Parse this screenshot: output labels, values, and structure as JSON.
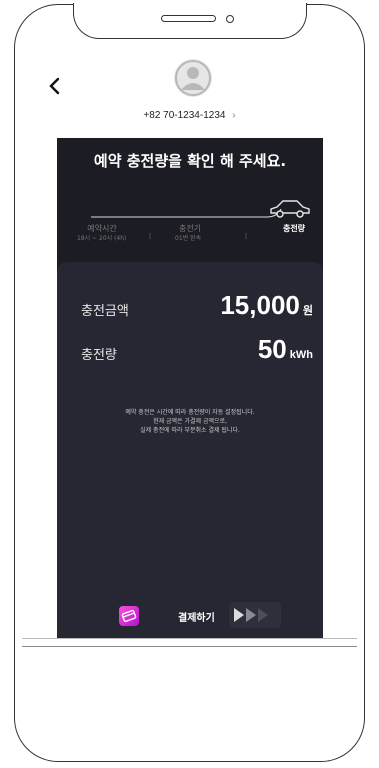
{
  "header": {
    "back_icon": "chevron-left-icon",
    "avatar_icon": "user-icon",
    "phone_number": "+82 70-1234-1234",
    "phone_chevron": "›"
  },
  "screen": {
    "title": "예약 충전량을 확인 해 주세요.",
    "steps": [
      {
        "label": "예약시간",
        "sub": "18시 ~ 20시 (4h)"
      },
      {
        "label": "충전기",
        "sub": "01번 완속"
      },
      {
        "label": "충전량",
        "sub": ""
      }
    ],
    "active_step": 2,
    "amount_label": "충전금액",
    "amount_value": "15,000",
    "amount_unit": "원",
    "kwh_label": "충전량",
    "kwh_value": "50",
    "kwh_unit": "kWh",
    "notice": [
      "예약 충전은 시간에 따라 충전량이 자동 설정됩니다.",
      "현재 금액은 가결제 금액으로,",
      "실제 충전에 따라 부분취소 결제 됩니다."
    ],
    "pay_label": "결제하기",
    "pay_icon": "credit-card-icon",
    "slide_icon": "triple-chevron-right-icon"
  },
  "colors": {
    "screen_bg": "#1c1c24",
    "card_bg": "#272733",
    "accent_gradient": [
      "#ff4fd8",
      "#b10fd6"
    ]
  }
}
